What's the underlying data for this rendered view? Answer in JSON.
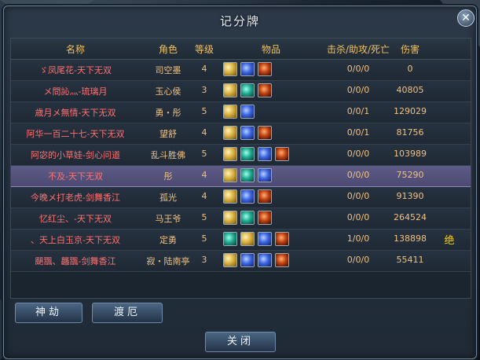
{
  "window": {
    "title": "记分牌",
    "close_label": "✕"
  },
  "columns": {
    "name": "名称",
    "role": "角色",
    "level": "等级",
    "items": "物品",
    "kda": "击杀/助攻/死亡",
    "damage": "伤害"
  },
  "rows": [
    {
      "name": "ゞ凤尾花-天下无双",
      "role": "司空墨",
      "level": "4",
      "items": [
        "gold",
        "blue",
        "red"
      ],
      "kda": "0/0/0",
      "damage": "0",
      "extra": ""
    },
    {
      "name": "メ問訫灬-琉璃月",
      "role": "玉心侯",
      "level": "3",
      "items": [
        "gold",
        "teal",
        "red"
      ],
      "kda": "0/0/0",
      "damage": "40805",
      "extra": ""
    },
    {
      "name": "歳月メ無情-天下无双",
      "role": "勇・彤",
      "level": "5",
      "items": [
        "gold",
        "blue"
      ],
      "kda": "0/0/1",
      "damage": "129029",
      "extra": ""
    },
    {
      "name": "阿华一百二十七-天下无双",
      "role": "望舒",
      "level": "4",
      "items": [
        "gold",
        "blue",
        "red"
      ],
      "kda": "0/0/1",
      "damage": "81756",
      "extra": ""
    },
    {
      "name": "阿宓的小草娃-剑心问道",
      "role": "乱斗胜佛",
      "level": "5",
      "items": [
        "gold",
        "teal",
        "blue",
        "red"
      ],
      "kda": "0/0/0",
      "damage": "103989",
      "extra": ""
    },
    {
      "name": "不及-天下无双",
      "role": "彤",
      "level": "4",
      "items": [
        "gold",
        "teal",
        "blue"
      ],
      "kda": "0/0/0",
      "damage": "75290",
      "extra": "",
      "selected": true
    },
    {
      "name": "今晚メ打老虎-剑舞香江",
      "role": "孤光",
      "level": "4",
      "items": [
        "gold",
        "blue",
        "red"
      ],
      "kda": "0/0/0",
      "damage": "91390",
      "extra": ""
    },
    {
      "name": "忆红尘、-天下无双",
      "role": "马王爷",
      "level": "5",
      "items": [
        "gold",
        "teal",
        "red"
      ],
      "kda": "0/0/0",
      "damage": "264524",
      "extra": ""
    },
    {
      "name": "、天上白玉京-天下无双",
      "role": "定勇",
      "level": "5",
      "items": [
        "teal",
        "gold",
        "blue",
        "red"
      ],
      "kda": "1/0/0",
      "damage": "138898",
      "extra": "绝"
    },
    {
      "name": "颶飁、龘飁-剑舞香江",
      "role": "寂・陆南亭",
      "level": "3",
      "items": [
        "gold",
        "blue",
        "blue",
        "red"
      ],
      "kda": "0/0/0",
      "damage": "55411",
      "extra": ""
    }
  ],
  "team_buttons": {
    "left": "神劫",
    "right": "渡厄"
  },
  "close_button": "关闭",
  "colors": {
    "name": "#ff7070",
    "stat": "#f0c080",
    "header": "#f0c060",
    "selected_row": "#56537e"
  }
}
